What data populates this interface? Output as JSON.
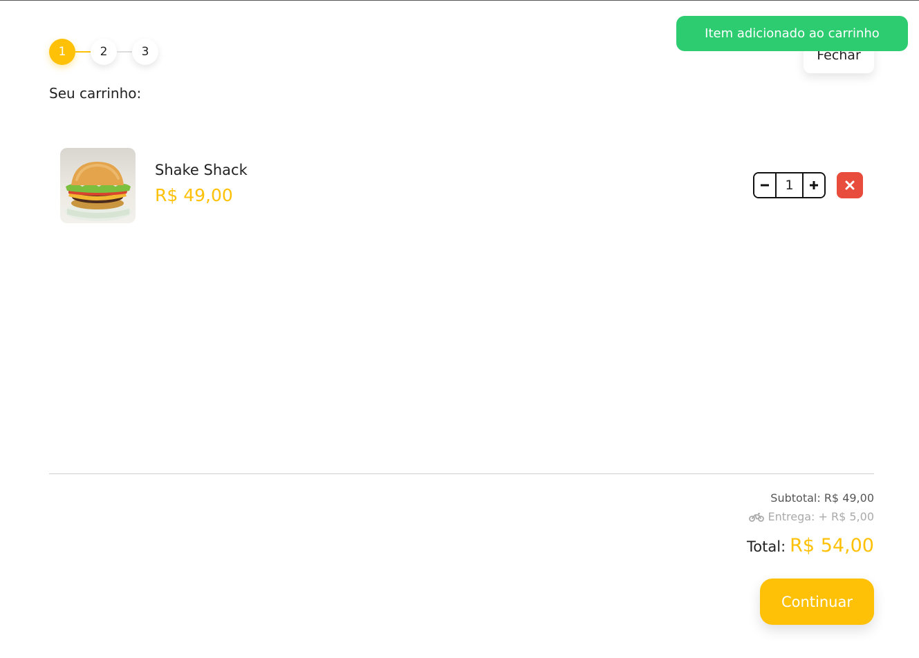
{
  "colors": {
    "accent": "#FFC107",
    "success": "#2ecc71",
    "danger": "#e74c3c"
  },
  "stepper": {
    "steps": [
      "1",
      "2",
      "3"
    ],
    "active_index": 0
  },
  "cart": {
    "title": "Seu carrinho:",
    "items": [
      {
        "name": "Shake Shack",
        "price": "R$ 49,00",
        "quantity": "1",
        "image_icon": "burger-photo"
      }
    ]
  },
  "header": {
    "close_label": "Fechar"
  },
  "toast": {
    "message": "Item adicionado ao carrinho"
  },
  "summary": {
    "subtotal": "Subtotal: R$ 49,00",
    "delivery_icon": "motorcycle-icon",
    "delivery": "Entrega: + R$ 5,00",
    "total_label": "Total:",
    "total_value": "R$ 54,00"
  },
  "actions": {
    "continue_label": "Continuar"
  }
}
